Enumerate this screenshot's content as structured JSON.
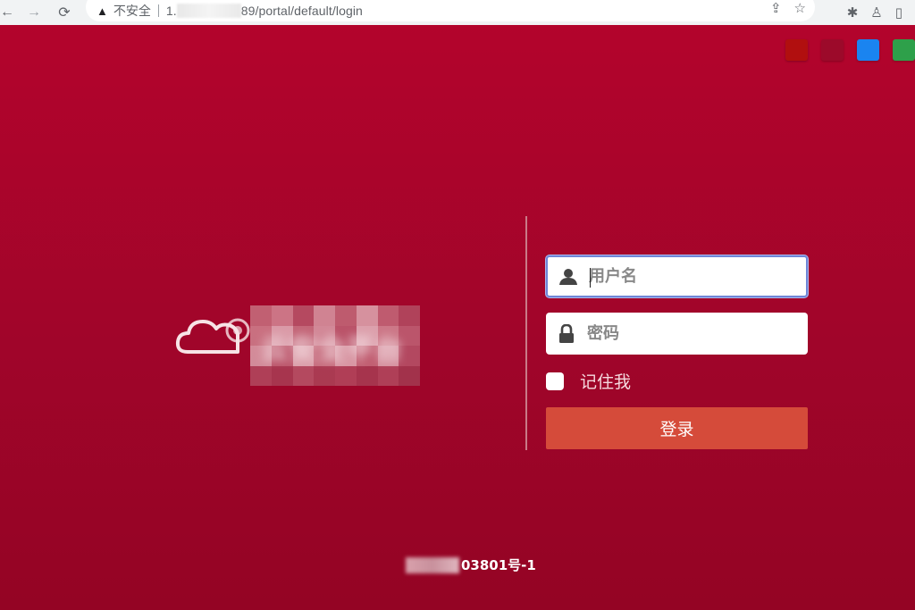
{
  "browser": {
    "security_label": "不安全",
    "url_prefix": "1.",
    "url_suffix": "89/portal/default/login"
  },
  "theme_swatches": [
    {
      "color": "#b10f0f"
    },
    {
      "color": "#9c0a2a"
    },
    {
      "color": "#1a84f0"
    },
    {
      "color": "#2ea04a"
    }
  ],
  "brand": {
    "text": "云安全平台"
  },
  "login": {
    "username_placeholder": "用户名",
    "password_placeholder": "密码",
    "remember_label": "记住我",
    "submit_label": "登录"
  },
  "footer": {
    "icp_visible": "03801号-1"
  },
  "colors": {
    "page_bg": "#a0052a",
    "login_button": "#d54b3a",
    "input_focus_border": "#6f86d6"
  }
}
